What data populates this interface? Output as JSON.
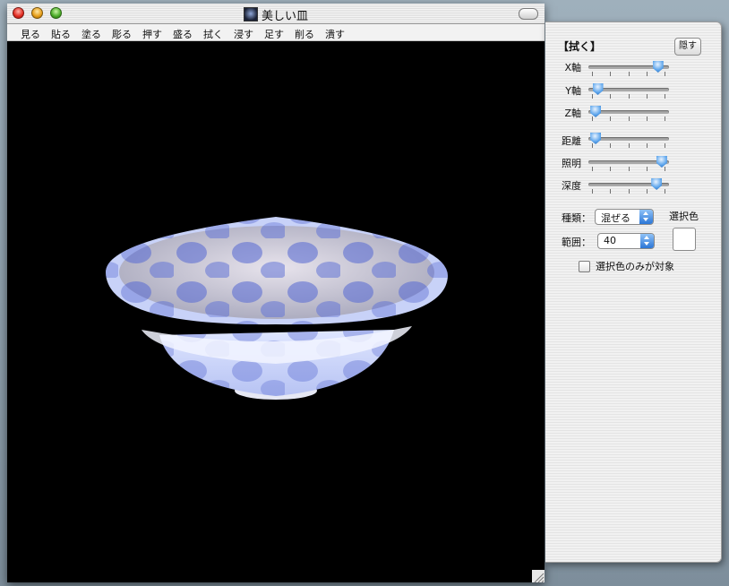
{
  "window": {
    "title": "美しい皿"
  },
  "menu": [
    "見る",
    "貼る",
    "塗る",
    "彫る",
    "押す",
    "盛る",
    "拭く",
    "浸す",
    "足す",
    "削る",
    "潰す"
  ],
  "panel": {
    "title": "【拭く】",
    "hide_label": "隠す",
    "sliders": [
      {
        "label": "X軸",
        "value": 0.9
      },
      {
        "label": "Y軸",
        "value": 0.08
      },
      {
        "label": "Z軸",
        "value": 0.05
      },
      {
        "label": "距離",
        "value": 0.05
      },
      {
        "label": "照明",
        "value": 0.95
      },
      {
        "label": "深度",
        "value": 0.88
      }
    ],
    "kind_label": "種類：",
    "kind_value": "混ぜる",
    "range_label": "範囲：",
    "range_value": "40",
    "selected_color_label": "選択色",
    "selected_color": "#ffffff",
    "only_selected_label": "選択色のみが対象",
    "only_selected_checked": false
  }
}
